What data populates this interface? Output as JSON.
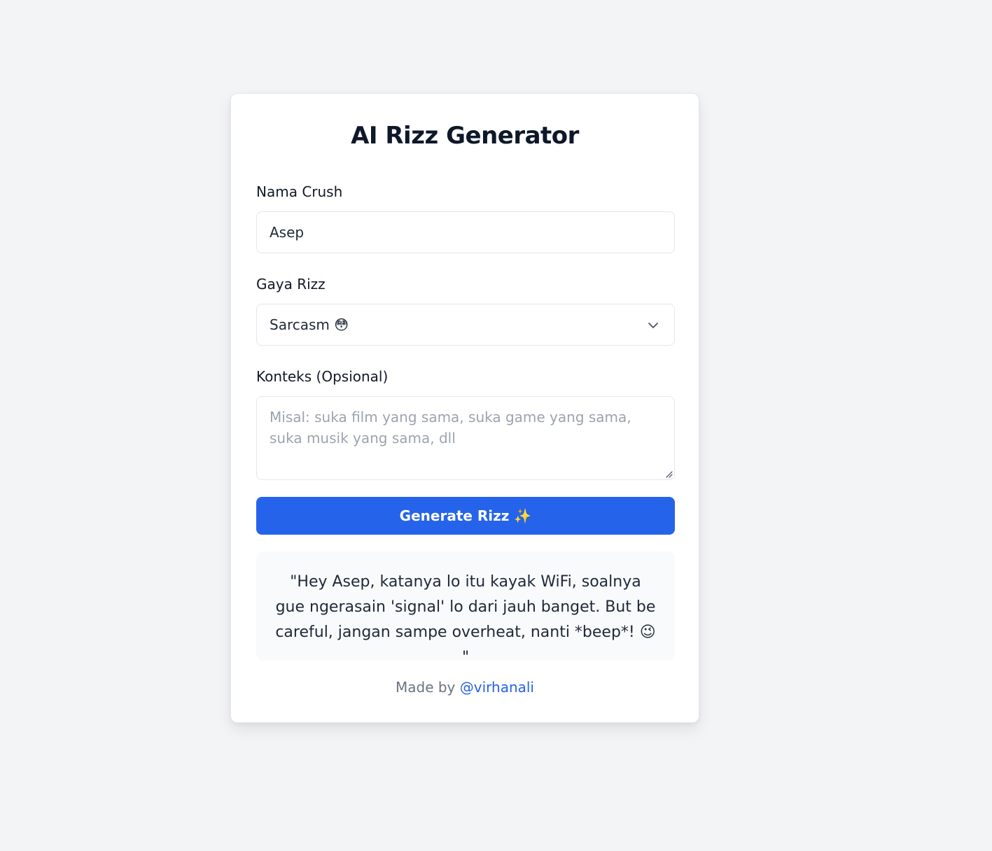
{
  "app": {
    "title": "AI Rizz Generator"
  },
  "form": {
    "name_label": "Nama Crush",
    "name_value": "Asep",
    "style_label": "Gaya Rizz",
    "style_value": "Sarcasm 😳",
    "context_label": "Konteks (Opsional)",
    "context_placeholder": "Misal: suka film yang sama, suka game yang sama, suka musik yang sama, dll",
    "generate_label": "Generate Rizz ✨"
  },
  "result": {
    "text": "\"Hey Asep, katanya lo itu kayak WiFi, soalnya gue ngerasain 'signal' lo dari jauh banget. But be careful, jangan sampe overheat, nanti *beep*! 😉 \""
  },
  "footer": {
    "prefix": "Made by",
    "author": "@virhanali"
  },
  "icons": {
    "select_chevron": "chevron-down-icon",
    "textarea_resize": "resize-handle-icon"
  },
  "colors": {
    "accent": "#2563eb",
    "background": "#f3f4f6"
  }
}
